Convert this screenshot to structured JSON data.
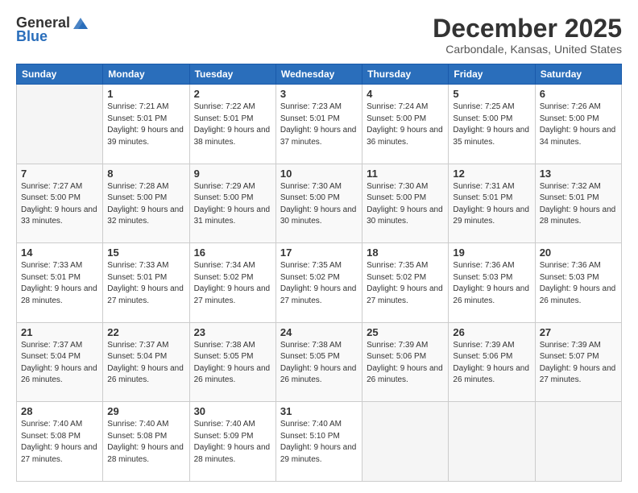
{
  "logo": {
    "general": "General",
    "blue": "Blue"
  },
  "title": "December 2025",
  "location": "Carbondale, Kansas, United States",
  "weekdays": [
    "Sunday",
    "Monday",
    "Tuesday",
    "Wednesday",
    "Thursday",
    "Friday",
    "Saturday"
  ],
  "weeks": [
    [
      {
        "day": "",
        "info": ""
      },
      {
        "day": "1",
        "info": "Sunrise: 7:21 AM\nSunset: 5:01 PM\nDaylight: 9 hours\nand 39 minutes."
      },
      {
        "day": "2",
        "info": "Sunrise: 7:22 AM\nSunset: 5:01 PM\nDaylight: 9 hours\nand 38 minutes."
      },
      {
        "day": "3",
        "info": "Sunrise: 7:23 AM\nSunset: 5:01 PM\nDaylight: 9 hours\nand 37 minutes."
      },
      {
        "day": "4",
        "info": "Sunrise: 7:24 AM\nSunset: 5:00 PM\nDaylight: 9 hours\nand 36 minutes."
      },
      {
        "day": "5",
        "info": "Sunrise: 7:25 AM\nSunset: 5:00 PM\nDaylight: 9 hours\nand 35 minutes."
      },
      {
        "day": "6",
        "info": "Sunrise: 7:26 AM\nSunset: 5:00 PM\nDaylight: 9 hours\nand 34 minutes."
      }
    ],
    [
      {
        "day": "7",
        "info": "Sunrise: 7:27 AM\nSunset: 5:00 PM\nDaylight: 9 hours\nand 33 minutes."
      },
      {
        "day": "8",
        "info": "Sunrise: 7:28 AM\nSunset: 5:00 PM\nDaylight: 9 hours\nand 32 minutes."
      },
      {
        "day": "9",
        "info": "Sunrise: 7:29 AM\nSunset: 5:00 PM\nDaylight: 9 hours\nand 31 minutes."
      },
      {
        "day": "10",
        "info": "Sunrise: 7:30 AM\nSunset: 5:00 PM\nDaylight: 9 hours\nand 30 minutes."
      },
      {
        "day": "11",
        "info": "Sunrise: 7:30 AM\nSunset: 5:00 PM\nDaylight: 9 hours\nand 30 minutes."
      },
      {
        "day": "12",
        "info": "Sunrise: 7:31 AM\nSunset: 5:01 PM\nDaylight: 9 hours\nand 29 minutes."
      },
      {
        "day": "13",
        "info": "Sunrise: 7:32 AM\nSunset: 5:01 PM\nDaylight: 9 hours\nand 28 minutes."
      }
    ],
    [
      {
        "day": "14",
        "info": "Sunrise: 7:33 AM\nSunset: 5:01 PM\nDaylight: 9 hours\nand 28 minutes."
      },
      {
        "day": "15",
        "info": "Sunrise: 7:33 AM\nSunset: 5:01 PM\nDaylight: 9 hours\nand 27 minutes."
      },
      {
        "day": "16",
        "info": "Sunrise: 7:34 AM\nSunset: 5:02 PM\nDaylight: 9 hours\nand 27 minutes."
      },
      {
        "day": "17",
        "info": "Sunrise: 7:35 AM\nSunset: 5:02 PM\nDaylight: 9 hours\nand 27 minutes."
      },
      {
        "day": "18",
        "info": "Sunrise: 7:35 AM\nSunset: 5:02 PM\nDaylight: 9 hours\nand 27 minutes."
      },
      {
        "day": "19",
        "info": "Sunrise: 7:36 AM\nSunset: 5:03 PM\nDaylight: 9 hours\nand 26 minutes."
      },
      {
        "day": "20",
        "info": "Sunrise: 7:36 AM\nSunset: 5:03 PM\nDaylight: 9 hours\nand 26 minutes."
      }
    ],
    [
      {
        "day": "21",
        "info": "Sunrise: 7:37 AM\nSunset: 5:04 PM\nDaylight: 9 hours\nand 26 minutes."
      },
      {
        "day": "22",
        "info": "Sunrise: 7:37 AM\nSunset: 5:04 PM\nDaylight: 9 hours\nand 26 minutes."
      },
      {
        "day": "23",
        "info": "Sunrise: 7:38 AM\nSunset: 5:05 PM\nDaylight: 9 hours\nand 26 minutes."
      },
      {
        "day": "24",
        "info": "Sunrise: 7:38 AM\nSunset: 5:05 PM\nDaylight: 9 hours\nand 26 minutes."
      },
      {
        "day": "25",
        "info": "Sunrise: 7:39 AM\nSunset: 5:06 PM\nDaylight: 9 hours\nand 26 minutes."
      },
      {
        "day": "26",
        "info": "Sunrise: 7:39 AM\nSunset: 5:06 PM\nDaylight: 9 hours\nand 26 minutes."
      },
      {
        "day": "27",
        "info": "Sunrise: 7:39 AM\nSunset: 5:07 PM\nDaylight: 9 hours\nand 27 minutes."
      }
    ],
    [
      {
        "day": "28",
        "info": "Sunrise: 7:40 AM\nSunset: 5:08 PM\nDaylight: 9 hours\nand 27 minutes."
      },
      {
        "day": "29",
        "info": "Sunrise: 7:40 AM\nSunset: 5:08 PM\nDaylight: 9 hours\nand 28 minutes."
      },
      {
        "day": "30",
        "info": "Sunrise: 7:40 AM\nSunset: 5:09 PM\nDaylight: 9 hours\nand 28 minutes."
      },
      {
        "day": "31",
        "info": "Sunrise: 7:40 AM\nSunset: 5:10 PM\nDaylight: 9 hours\nand 29 minutes."
      },
      {
        "day": "",
        "info": ""
      },
      {
        "day": "",
        "info": ""
      },
      {
        "day": "",
        "info": ""
      }
    ]
  ]
}
